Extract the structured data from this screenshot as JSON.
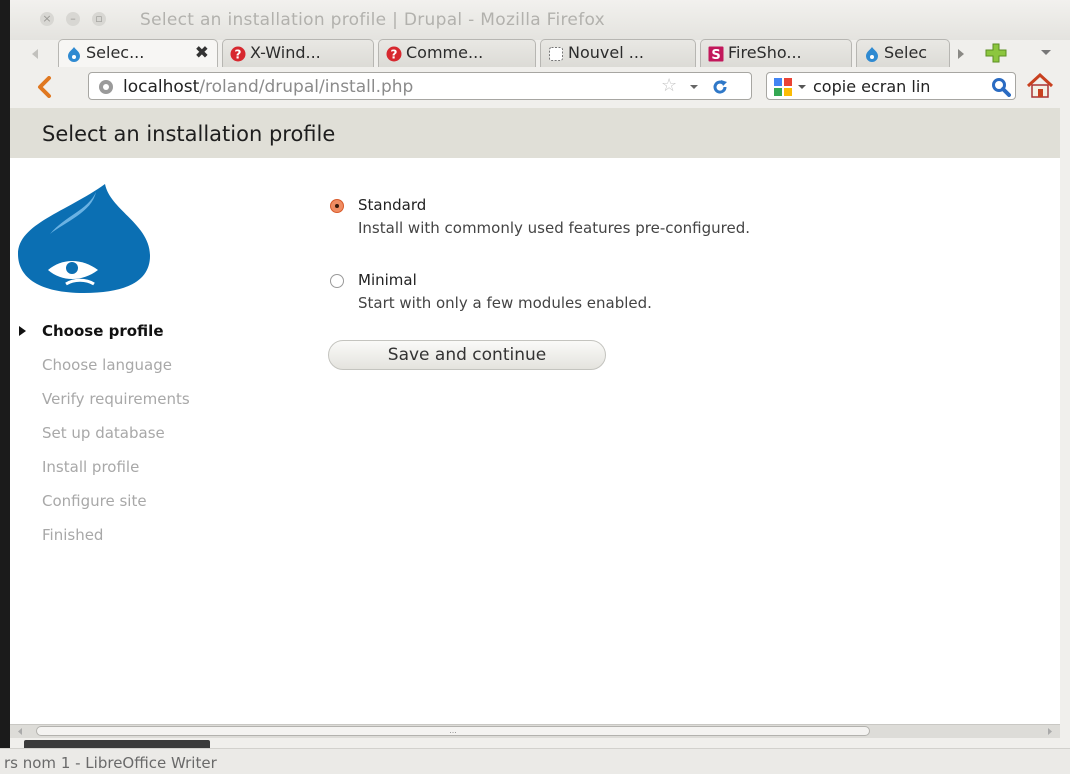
{
  "window": {
    "title": "Select an installation profile | Drupal - Mozilla Firefox"
  },
  "tabs": [
    {
      "label": "Selec...",
      "icon": "drupal-icon",
      "active": true
    },
    {
      "label": "X-Wind...",
      "icon": "question-icon"
    },
    {
      "label": "Comme...",
      "icon": "question-icon"
    },
    {
      "label": "Nouvel ...",
      "icon": "blank-page-icon"
    },
    {
      "label": "FireSho...",
      "icon": "fireshot-icon"
    },
    {
      "label": "Selec",
      "icon": "drupal-icon"
    }
  ],
  "nav": {
    "url_host": "localhost",
    "url_path": "/roland/drupal/install.php",
    "search_value": "copie ecran lin"
  },
  "page": {
    "title": "Select an installation profile",
    "steps": [
      {
        "label": "Choose profile",
        "active": true
      },
      {
        "label": "Choose language"
      },
      {
        "label": "Verify requirements"
      },
      {
        "label": "Set up database"
      },
      {
        "label": "Install profile"
      },
      {
        "label": "Configure site"
      },
      {
        "label": "Finished"
      }
    ],
    "options": [
      {
        "label": "Standard",
        "description": "Install with commonly used features pre-configured.",
        "selected": true
      },
      {
        "label": "Minimal",
        "description": "Start with only a few modules enabled.",
        "selected": false
      }
    ],
    "submit_label": "Save and continue"
  },
  "scrollbar": {
    "grip": "..."
  },
  "taskbar": {
    "label": "rs nom 1 - LibreOffice Writer"
  },
  "colors": {
    "accent": "#2f8ad1",
    "radio_selected": "#e06a36",
    "header_bg": "#e0dfd7"
  }
}
